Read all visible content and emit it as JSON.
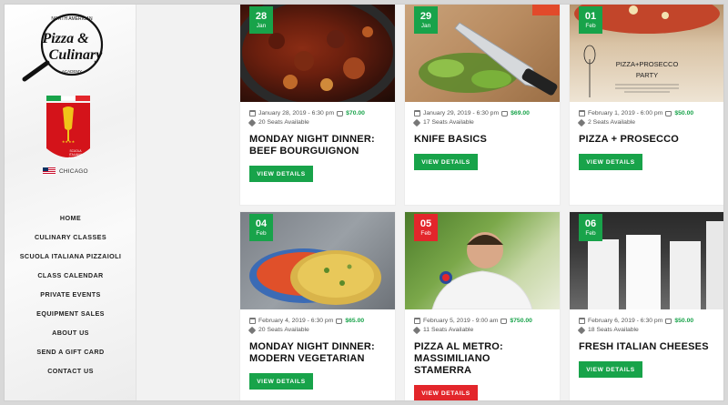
{
  "brand": {
    "logo_top": "NORTH AMERICAN",
    "logo_line1": "Pizza &",
    "logo_line2": "Culinary",
    "logo_bottom": "ACADEMY",
    "school_text": "SCUOLA ITALIANA PIZZAIOLI",
    "city": "CHICAGO"
  },
  "nav": [
    {
      "label": "HOME"
    },
    {
      "label": "CULINARY CLASSES"
    },
    {
      "label": "SCUOLA ITALIANA PIZZAIOLI"
    },
    {
      "label": "CLASS CALENDAR"
    },
    {
      "label": "PRIVATE EVENTS"
    },
    {
      "label": "EQUIPMENT SALES"
    },
    {
      "label": "ABOUT US"
    },
    {
      "label": "SEND A GIFT CARD"
    },
    {
      "label": "CONTACT US"
    }
  ],
  "events": [
    {
      "day": "28",
      "month": "Jan",
      "datetime": "January 28, 2019 - 6:30 pm",
      "price": "$70.00",
      "seats": "20 Seats Available",
      "title1": "MONDAY NIGHT DINNER:",
      "title2": "BEEF BOURGUIGNON",
      "button": "VIEW DETAILS",
      "status": "green"
    },
    {
      "day": "29",
      "month": "Jan",
      "datetime": "January 29, 2019 - 6:30 pm",
      "price": "$69.00",
      "seats": "17 Seats Available",
      "title1": "KNIFE BASICS",
      "title2": "",
      "button": "VIEW DETAILS",
      "status": "green"
    },
    {
      "day": "01",
      "month": "Feb",
      "datetime": "February 1, 2019 - 6:00 pm",
      "price": "$50.00",
      "seats": "2 Seats Available",
      "title1": "PIZZA + PROSECCO",
      "title2": "",
      "button": "VIEW DETAILS",
      "status": "green",
      "poster_title": "PIZZA+PROSECCO",
      "poster_sub": "PARTY"
    },
    {
      "day": "04",
      "month": "Feb",
      "datetime": "February 4, 2019 - 6:30 pm",
      "price": "$65.00",
      "seats": "20 Seats Available",
      "title1": "MONDAY NIGHT DINNER:",
      "title2": "MODERN VEGETARIAN",
      "button": "VIEW DETAILS",
      "status": "green"
    },
    {
      "day": "05",
      "month": "Feb",
      "datetime": "February 5, 2019 - 9:00 am",
      "price": "$750.00",
      "seats": "11 Seats Available",
      "title1": "PIZZA AL METRO:",
      "title2": "MASSIMILIANO STAMERRA",
      "button": "VIEW DETAILS",
      "status": "red"
    },
    {
      "day": "06",
      "month": "Feb",
      "datetime": "February 6, 2019 - 6:30 pm",
      "price": "$50.00",
      "seats": "18 Seats Available",
      "title1": "FRESH ITALIAN CHEESES",
      "title2": "",
      "button": "VIEW DETAILS",
      "status": "green"
    }
  ],
  "colors": {
    "accent_green": "#18a34a",
    "accent_red": "#e3262b"
  },
  "icons": [
    "calendar-icon",
    "basket-icon",
    "tag-icon",
    "us-flag-icon",
    "skillet-logo-icon"
  ]
}
